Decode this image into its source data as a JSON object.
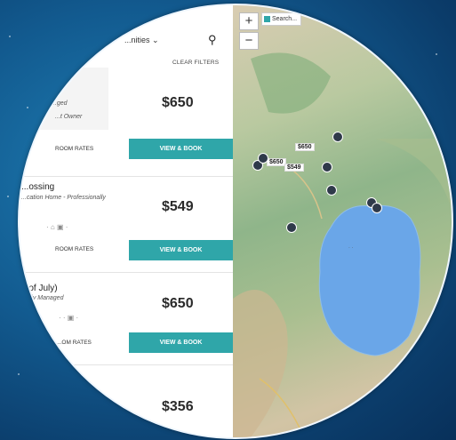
{
  "toolbar": {
    "sort_label": "...nities",
    "clear_filters_label": "CLEAR FILTERS"
  },
  "listings": [
    {
      "title": "",
      "line1": "...ged",
      "line2": "...t Owner",
      "price": "$650",
      "rates_label": "ROOM RATES",
      "book_label": "VIEW & BOOK"
    },
    {
      "title": "...ossing",
      "subtitle": "...cation Home - Professionally",
      "price": "$549",
      "rates_label": "ROOM RATES",
      "book_label": "VIEW & BOOK"
    },
    {
      "title": "...of July)",
      "subtitle": "...ally Managed",
      "price": "$650",
      "rates_label": "...OM RATES",
      "book_label": "VIEW & BOOK"
    },
    {
      "price": "$356"
    }
  ],
  "map": {
    "zoom_in": "+",
    "zoom_out": "−",
    "search_as_move_label": "Search...",
    "price_pins": [
      "$650",
      "$650",
      "$549"
    ],
    "lake_color": "#6aa6e8"
  },
  "colors": {
    "accent": "#2fa6a9",
    "background": "#125a8f"
  }
}
